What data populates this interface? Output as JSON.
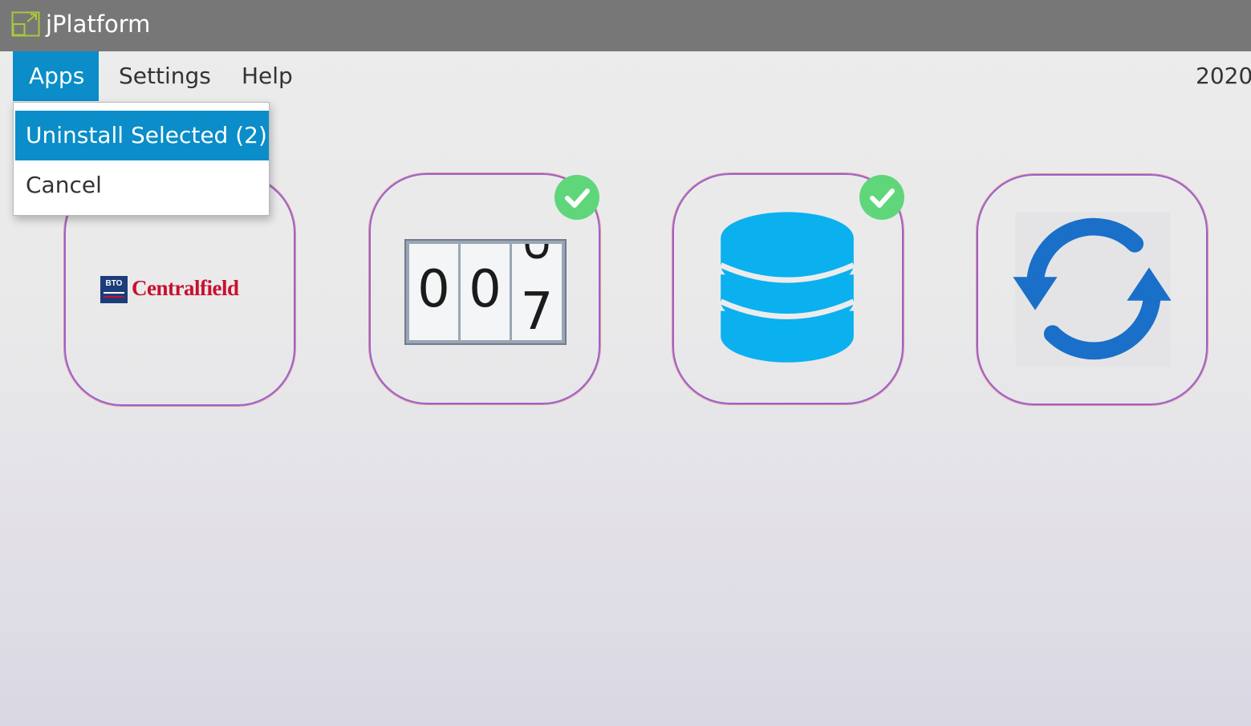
{
  "window": {
    "title": "jPlatform"
  },
  "menubar": {
    "items": [
      {
        "label": "Apps",
        "active": true
      },
      {
        "label": "Settings",
        "active": false
      },
      {
        "label": "Help",
        "active": false
      }
    ],
    "date_text": "2020-"
  },
  "dropdown": {
    "items": [
      {
        "label": "Uninstall Selected (2)",
        "highlighted": true
      },
      {
        "label": "Cancel",
        "highlighted": false
      }
    ]
  },
  "tiles": [
    {
      "name": "centralfield-app",
      "icon": "centralfield-logo",
      "logo_badge": "BTO",
      "logo_text": "Centralfield",
      "selected": false
    },
    {
      "name": "counter-app",
      "icon": "counter-icon",
      "digits": [
        "0",
        "0",
        "7"
      ],
      "selected": true
    },
    {
      "name": "database-app",
      "icon": "database-icon",
      "selected": true
    },
    {
      "name": "sync-app",
      "icon": "sync-icon",
      "selected": false
    }
  ],
  "colors": {
    "titlebar": "#777777",
    "accent": "#0a8dc8",
    "check": "#5fd67a",
    "database": "#0bb0ef",
    "sync": "#1a6fc9",
    "centralfield_red": "#c8102e",
    "tile_border": "#9a62c9"
  }
}
